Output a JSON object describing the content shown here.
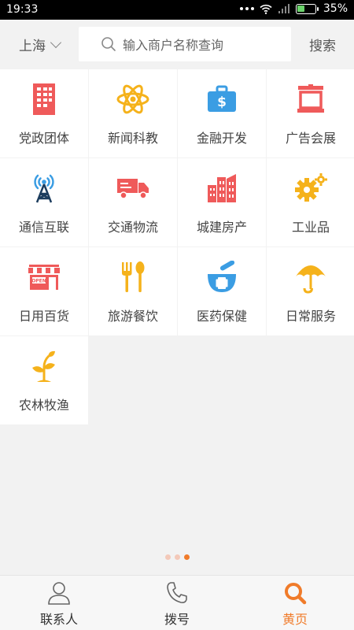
{
  "status_bar": {
    "time": "19:33",
    "battery": "35%"
  },
  "header": {
    "city": "上海",
    "search_placeholder": "输入商户名称查询",
    "search_button": "搜索"
  },
  "categories": [
    {
      "label": "党政团体",
      "icon": "building-icon",
      "color": "#ef5a5a"
    },
    {
      "label": "新闻科教",
      "icon": "atom-icon",
      "color": "#f5b21b"
    },
    {
      "label": "金融开发",
      "icon": "money-case-icon",
      "color": "#3b9de3"
    },
    {
      "label": "广告会展",
      "icon": "billboard-icon",
      "color": "#ef5a5a"
    },
    {
      "label": "通信互联",
      "icon": "antenna-icon",
      "color": "#3b9de3"
    },
    {
      "label": "交通物流",
      "icon": "truck-icon",
      "color": "#ef5a5a"
    },
    {
      "label": "城建房产",
      "icon": "city-buildings-icon",
      "color": "#ef5a5a"
    },
    {
      "label": "工业品",
      "icon": "gears-icon",
      "color": "#f5b21b"
    },
    {
      "label": "日用百货",
      "icon": "store-icon",
      "color": "#ef5a5a"
    },
    {
      "label": "旅游餐饮",
      "icon": "fork-spoon-icon",
      "color": "#f5b21b"
    },
    {
      "label": "医药保健",
      "icon": "medicine-icon",
      "color": "#3b9de3"
    },
    {
      "label": "日常服务",
      "icon": "umbrella-icon",
      "color": "#f5b21b"
    },
    {
      "label": "农林牧渔",
      "icon": "plant-icon",
      "color": "#f5b21b"
    }
  ],
  "pager": {
    "pages": 3,
    "current": 3
  },
  "bottom_nav": [
    {
      "label": "联系人",
      "icon": "contact-icon",
      "active": false
    },
    {
      "label": "拨号",
      "icon": "phone-icon",
      "active": false
    },
    {
      "label": "黄页",
      "icon": "search-icon",
      "active": true
    }
  ],
  "accent_color": "#f07b2a"
}
